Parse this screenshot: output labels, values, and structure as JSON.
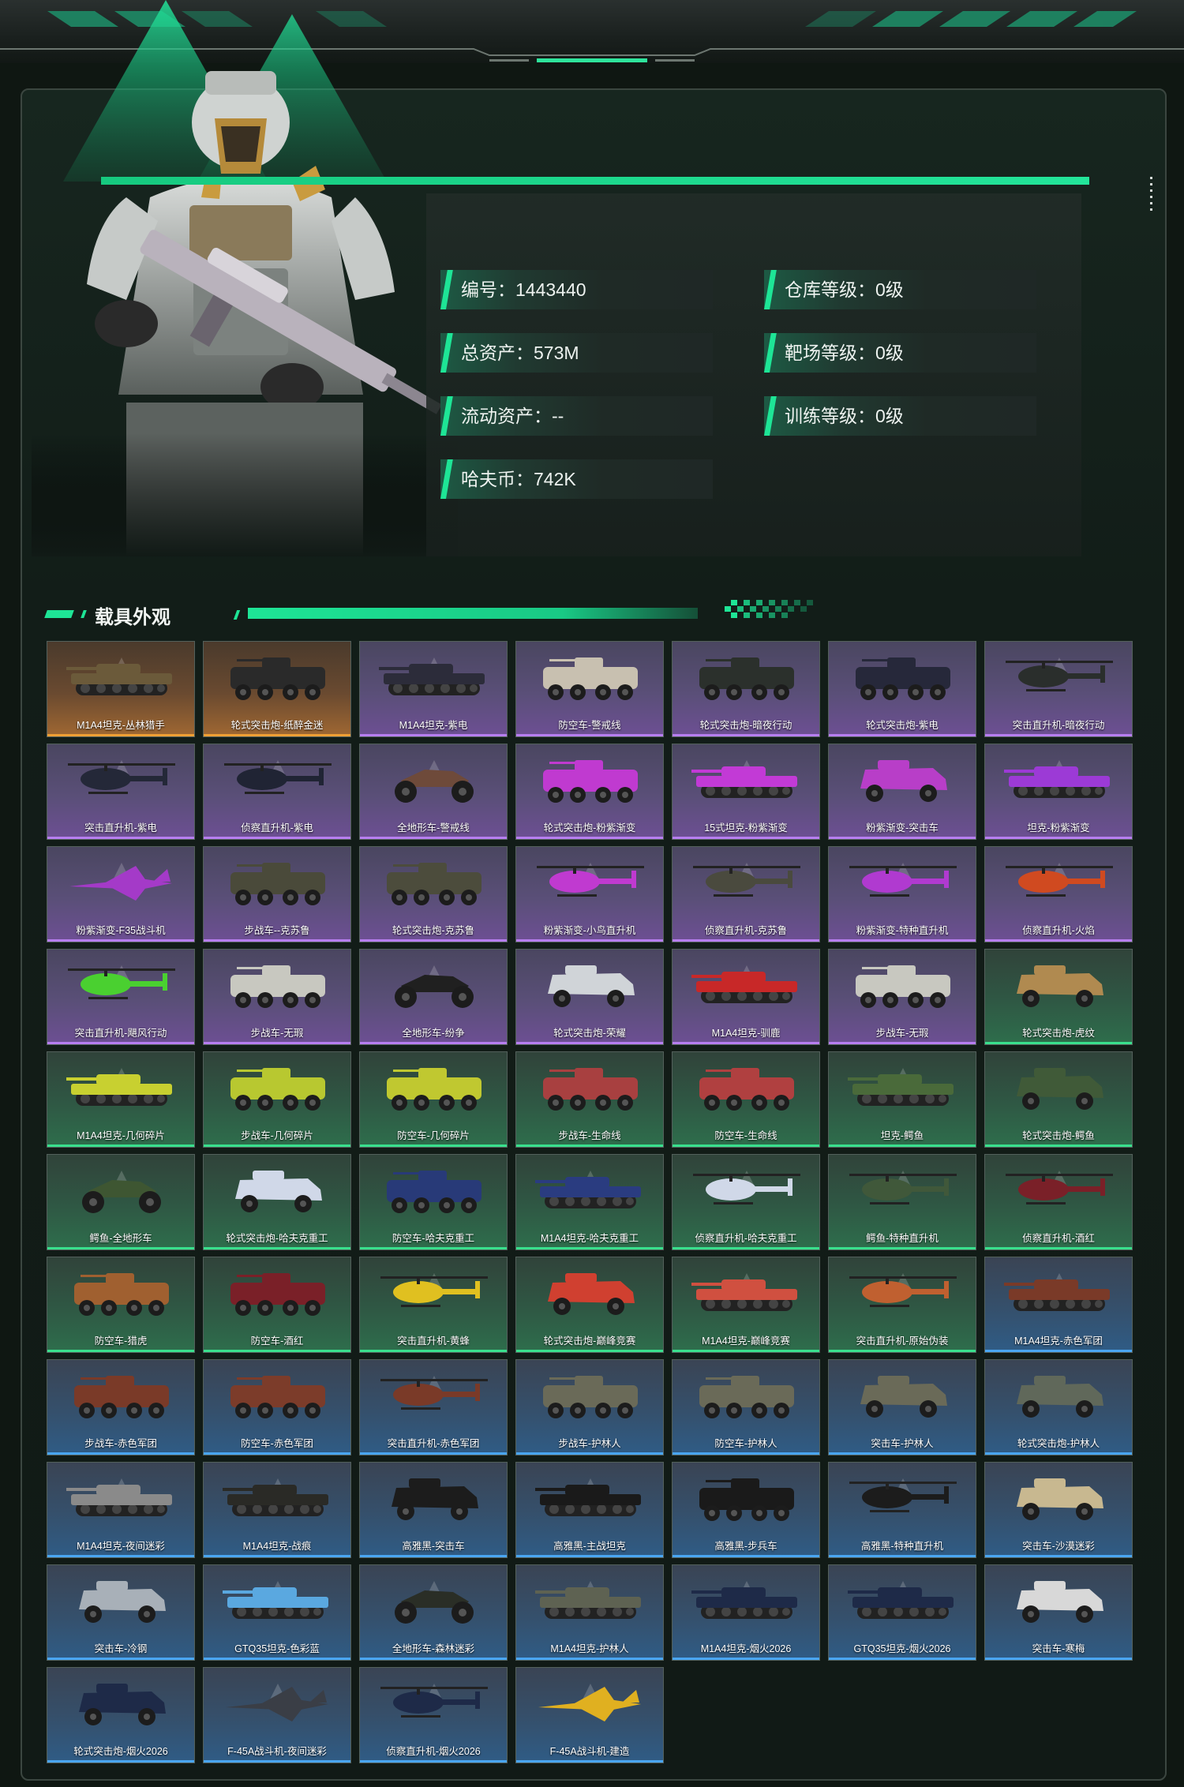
{
  "profile": {
    "stats": [
      {
        "label": "编号：1443440"
      },
      {
        "label": "仓库等级：0级"
      },
      {
        "label": "总资产：573M"
      },
      {
        "label": "靶场等级：0级"
      },
      {
        "label": "流动资产：--"
      },
      {
        "label": "训练等级：0级"
      },
      {
        "label": "哈夫币：742K"
      }
    ]
  },
  "section": {
    "title": "载具外观"
  },
  "colors": {
    "accent": "#1ee596",
    "rarity": {
      "orange": "#f0a035",
      "purple": "#b77ef0",
      "green": "#39e08d",
      "blue": "#4aa6f2"
    }
  },
  "skins": [
    {
      "name": "M1A4坦克-丛林猎手",
      "rarity": "orange",
      "kind": "tank",
      "color": "#6b5a3a"
    },
    {
      "name": "轮式突击炮-纸醉金迷",
      "rarity": "orange",
      "kind": "apc",
      "color": "#2a2a2a"
    },
    {
      "name": "M1A4坦克-紫电",
      "rarity": "purple",
      "kind": "tank",
      "color": "#2c2c3a"
    },
    {
      "name": "防空车-警戒线",
      "rarity": "purple",
      "kind": "apc",
      "color": "#c8c0b0"
    },
    {
      "name": "轮式突击炮-暗夜行动",
      "rarity": "purple",
      "kind": "apc",
      "color": "#2b302c"
    },
    {
      "name": "轮式突击炮-紫电",
      "rarity": "purple",
      "kind": "apc",
      "color": "#26283a"
    },
    {
      "name": "突击直升机-暗夜行动",
      "rarity": "purple",
      "kind": "heli",
      "color": "#2a2e2c"
    },
    {
      "name": "突击直升机-紫电",
      "rarity": "purple",
      "kind": "heli",
      "color": "#242838"
    },
    {
      "name": "侦察直升机-紫电",
      "rarity": "purple",
      "kind": "heli",
      "color": "#202434"
    },
    {
      "name": "全地形车-警戒线",
      "rarity": "purple",
      "kind": "atv",
      "color": "#6e4a3a"
    },
    {
      "name": "轮式突击炮-粉紫渐变",
      "rarity": "purple",
      "kind": "apc",
      "color": "#c03ad0"
    },
    {
      "name": "15式坦克-粉紫渐变",
      "rarity": "purple",
      "kind": "tank",
      "color": "#c23ad6"
    },
    {
      "name": "粉紫渐变-突击车",
      "rarity": "purple",
      "kind": "car",
      "color": "#b83ec8"
    },
    {
      "name": "坦克-粉紫渐变",
      "rarity": "purple",
      "kind": "tank",
      "color": "#9c3ad6"
    },
    {
      "name": "粉紫渐变-F35战斗机",
      "rarity": "purple",
      "kind": "jet",
      "color": "#a43ac8"
    },
    {
      "name": "步战车--克苏鲁",
      "rarity": "purple",
      "kind": "apc",
      "color": "#4a4a3a"
    },
    {
      "name": "轮式突击炮-克苏鲁",
      "rarity": "purple",
      "kind": "apc",
      "color": "#4c4c3c"
    },
    {
      "name": "粉紫渐变-小鸟直升机",
      "rarity": "purple",
      "kind": "heli",
      "color": "#c03ad0"
    },
    {
      "name": "侦察直升机-克苏鲁",
      "rarity": "purple",
      "kind": "heli",
      "color": "#4a4a3e"
    },
    {
      "name": "粉紫渐变-特种直升机",
      "rarity": "purple",
      "kind": "heli",
      "color": "#b03ad0"
    },
    {
      "name": "侦察直升机-火焰",
      "rarity": "purple",
      "kind": "heli",
      "color": "#d04a20"
    },
    {
      "name": "突击直升机-飓风行动",
      "rarity": "purple",
      "kind": "heli",
      "color": "#4ad030"
    },
    {
      "name": "步战车-无瑕",
      "rarity": "purple",
      "kind": "apc",
      "color": "#c8c8c0"
    },
    {
      "name": "全地形车-纷争",
      "rarity": "purple",
      "kind": "atv",
      "color": "#202020"
    },
    {
      "name": "轮式突击炮-荣耀",
      "rarity": "purple",
      "kind": "car",
      "color": "#d0d4d8"
    },
    {
      "name": "M1A4坦克-驯鹿",
      "rarity": "purple",
      "kind": "tank",
      "color": "#c82828"
    },
    {
      "name": "步战车-无瑕",
      "rarity": "purple",
      "kind": "apc",
      "color": "#c8c8c0"
    },
    {
      "name": "轮式突击炮-虎纹",
      "rarity": "green",
      "kind": "car",
      "color": "#b08a50"
    },
    {
      "name": "M1A4坦克-几何碎片",
      "rarity": "green",
      "kind": "tank",
      "color": "#c8d030"
    },
    {
      "name": "步战车-几何碎片",
      "rarity": "green",
      "kind": "apc",
      "color": "#b8c830"
    },
    {
      "name": "防空车-几何碎片",
      "rarity": "green",
      "kind": "apc",
      "color": "#c0c830"
    },
    {
      "name": "步战车-生命线",
      "rarity": "green",
      "kind": "apc",
      "color": "#a84040"
    },
    {
      "name": "防空车-生命线",
      "rarity": "green",
      "kind": "apc",
      "color": "#b04040"
    },
    {
      "name": "坦克-鳄鱼",
      "rarity": "green",
      "kind": "tank",
      "color": "#4a6a3a"
    },
    {
      "name": "轮式突击炮-鳄鱼",
      "rarity": "green",
      "kind": "car",
      "color": "#405a38"
    },
    {
      "name": "鳄鱼-全地形车",
      "rarity": "green",
      "kind": "atv",
      "color": "#3e5632"
    },
    {
      "name": "轮式突击炮-哈夫克重工",
      "rarity": "green",
      "kind": "car",
      "color": "#d0d8e8"
    },
    {
      "name": "防空车-哈夫克重工",
      "rarity": "green",
      "kind": "apc",
      "color": "#283a78"
    },
    {
      "name": "M1A4坦克-哈夫克重工",
      "rarity": "green",
      "kind": "tank",
      "color": "#2a3c80"
    },
    {
      "name": "侦察直升机-哈夫克重工",
      "rarity": "green",
      "kind": "heli",
      "color": "#d0d8e8"
    },
    {
      "name": "鳄鱼-特种直升机",
      "rarity": "green",
      "kind": "heli",
      "color": "#40583a"
    },
    {
      "name": "侦察直升机-酒红",
      "rarity": "green",
      "kind": "heli",
      "color": "#7a2028"
    },
    {
      "name": "防空车-猎虎",
      "rarity": "green",
      "kind": "apc",
      "color": "#a06030"
    },
    {
      "name": "防空车-酒红",
      "rarity": "green",
      "kind": "apc",
      "color": "#7a2028"
    },
    {
      "name": "突击直升机-黄蜂",
      "rarity": "green",
      "kind": "heli",
      "color": "#e0c020"
    },
    {
      "name": "轮式突击炮-巅峰竞赛",
      "rarity": "green",
      "kind": "car",
      "color": "#d04030"
    },
    {
      "name": "M1A4坦克-巅峰竞赛",
      "rarity": "green",
      "kind": "tank",
      "color": "#d05040"
    },
    {
      "name": "突击直升机-原始伪装",
      "rarity": "green",
      "kind": "heli",
      "color": "#c06030"
    },
    {
      "name": "M1A4坦克-赤色军团",
      "rarity": "blue",
      "kind": "tank",
      "color": "#7a3a28"
    },
    {
      "name": "步战车-赤色军团",
      "rarity": "blue",
      "kind": "apc",
      "color": "#7a3a28"
    },
    {
      "name": "防空车-赤色军团",
      "rarity": "blue",
      "kind": "apc",
      "color": "#7c3c2a"
    },
    {
      "name": "突击直升机-赤色军团",
      "rarity": "blue",
      "kind": "heli",
      "color": "#7a3a28"
    },
    {
      "name": "步战车-护林人",
      "rarity": "blue",
      "kind": "apc",
      "color": "#6a6a58"
    },
    {
      "name": "防空车-护林人",
      "rarity": "blue",
      "kind": "apc",
      "color": "#6a6a58"
    },
    {
      "name": "突击车-护林人",
      "rarity": "blue",
      "kind": "car",
      "color": "#6a6a58"
    },
    {
      "name": "轮式突击炮-护林人",
      "rarity": "blue",
      "kind": "car",
      "color": "#60685a"
    },
    {
      "name": "M1A4坦克-夜间迷彩",
      "rarity": "blue",
      "kind": "tank",
      "color": "#8a8a8a"
    },
    {
      "name": "M1A4坦克-战痕",
      "rarity": "blue",
      "kind": "tank",
      "color": "#2a2a26"
    },
    {
      "name": "高雅黑-突击车",
      "rarity": "blue",
      "kind": "car",
      "color": "#1c1c1c"
    },
    {
      "name": "高雅黑-主战坦克",
      "rarity": "blue",
      "kind": "tank",
      "color": "#1a1a1a"
    },
    {
      "name": "高雅黑-步兵车",
      "rarity": "blue",
      "kind": "apc",
      "color": "#1a1a1a"
    },
    {
      "name": "高雅黑-特种直升机",
      "rarity": "blue",
      "kind": "heli",
      "color": "#1c1c1c"
    },
    {
      "name": "突击车-沙漠迷彩",
      "rarity": "blue",
      "kind": "car",
      "color": "#c8b890"
    },
    {
      "name": "突击车-冷钢",
      "rarity": "blue",
      "kind": "car",
      "color": "#a8b0b8"
    },
    {
      "name": "GTQ35坦克-色彩蓝",
      "rarity": "blue",
      "kind": "tank",
      "color": "#5aa8e0"
    },
    {
      "name": "全地形车-森林迷彩",
      "rarity": "blue",
      "kind": "atv",
      "color": "#2a2e26"
    },
    {
      "name": "M1A4坦克-护林人",
      "rarity": "blue",
      "kind": "tank",
      "color": "#5e6252"
    },
    {
      "name": "M1A4坦克-烟火2026",
      "rarity": "blue",
      "kind": "tank",
      "color": "#1e2a48"
    },
    {
      "name": "GTQ35坦克-烟火2026",
      "rarity": "blue",
      "kind": "tank",
      "color": "#1e2a48"
    },
    {
      "name": "突击车-寒梅",
      "rarity": "blue",
      "kind": "car",
      "color": "#d8d8d8"
    },
    {
      "name": "轮式突击炮-烟火2026",
      "rarity": "blue",
      "kind": "car",
      "color": "#1e2a48"
    },
    {
      "name": "F-45A战斗机-夜间迷彩",
      "rarity": "blue",
      "kind": "jet",
      "color": "#3a3e46"
    },
    {
      "name": "侦察直升机-烟火2026",
      "rarity": "blue",
      "kind": "heli",
      "color": "#1e2a48"
    },
    {
      "name": "F-45A战斗机-建造",
      "rarity": "blue",
      "kind": "jet",
      "color": "#e0b020"
    }
  ]
}
